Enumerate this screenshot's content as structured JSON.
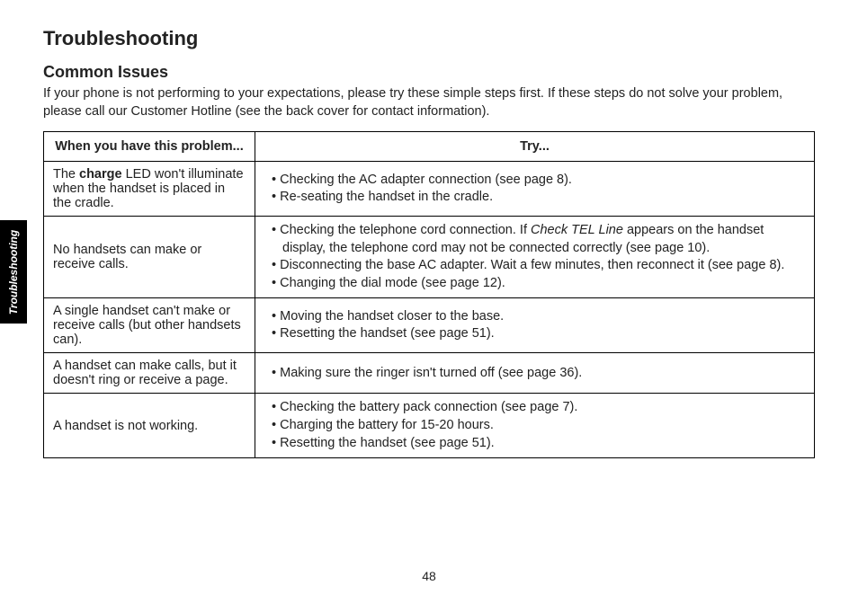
{
  "sideTab": "Troubleshooting",
  "title": "Troubleshooting",
  "subtitle": "Common Issues",
  "intro": "If your phone is not performing to your expectations, please try these simple steps first. If these steps do not solve your problem, please call our Customer Hotline (see the back cover for contact information).",
  "table": {
    "header": {
      "problem": "When you have this problem...",
      "try": "Try..."
    },
    "rows": [
      {
        "problem_pre": "The ",
        "problem_bold": "charge",
        "problem_post": " LED won't illuminate when the handset is placed in the cradle.",
        "tries": [
          "Checking the AC adapter connection (see page 8).",
          "Re-seating the handset in the cradle."
        ]
      },
      {
        "problem": "No handsets can make or receive calls.",
        "tries_special": {
          "a_pre": "Checking the telephone cord connection. If ",
          "a_italic": "Check TEL Line",
          "a_post": " appears on the handset display, the telephone cord may not be connected correctly (see page 10).",
          "b": "Disconnecting the base AC adapter. Wait a few minutes, then reconnect it (see page 8).",
          "c": "Changing the dial mode (see page 12)."
        }
      },
      {
        "problem": "A single handset can't make or receive calls (but other handsets can).",
        "tries": [
          "Moving the handset closer to the base.",
          "Resetting the handset (see page 51)."
        ]
      },
      {
        "problem": "A handset can make calls, but it doesn't ring or receive a page.",
        "tries": [
          "Making sure the ringer isn't turned off (see page 36)."
        ]
      },
      {
        "problem": "A handset is not working.",
        "tries": [
          "Checking the battery pack connection (see page 7).",
          "Charging the battery for 15-20 hours.",
          "Resetting the handset (see page 51)."
        ]
      }
    ]
  },
  "pageNumber": "48"
}
